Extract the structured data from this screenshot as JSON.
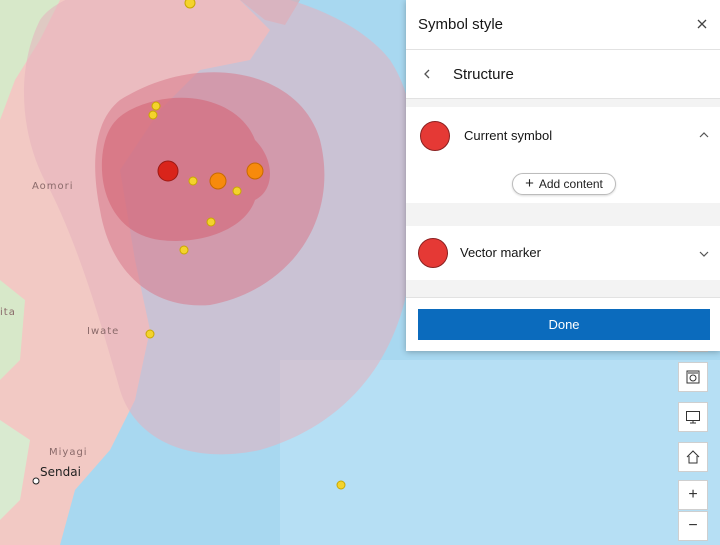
{
  "map": {
    "labels": {
      "aomori": "Aomori",
      "iwate": "Iwate",
      "miyagi": "Miyagi",
      "sendai": "Sendai",
      "ita": "ita"
    },
    "colors": {
      "sea": "#a8d8f0",
      "land": "#f2c9c4",
      "outer_zone": "#e6b0be",
      "inner_zone": "#d97a8a",
      "core_zone": "#d46676",
      "marker_red": "#d9241b",
      "marker_orange": "#f78a0c",
      "marker_yellow": "#f4d32c"
    }
  },
  "map_controls": {
    "buttons": [
      {
        "icon": "layers-icon"
      },
      {
        "icon": "basemap-icon"
      },
      {
        "icon": "home-icon"
      },
      {
        "icon": "zoom-in-icon",
        "label": "+"
      },
      {
        "icon": "zoom-out-icon",
        "label": "−"
      }
    ]
  },
  "panel": {
    "title": "Symbol style",
    "close_icon": "close-icon",
    "subheader": {
      "back_icon": "chevron-left-icon",
      "title": "Structure"
    },
    "current_symbol": {
      "label": "Current symbol",
      "color": "#e53935",
      "expanded": true,
      "add_content_label": "Add content"
    },
    "vector_marker": {
      "label": "Vector marker",
      "color": "#e53935",
      "expanded": false
    },
    "done_label": "Done"
  }
}
